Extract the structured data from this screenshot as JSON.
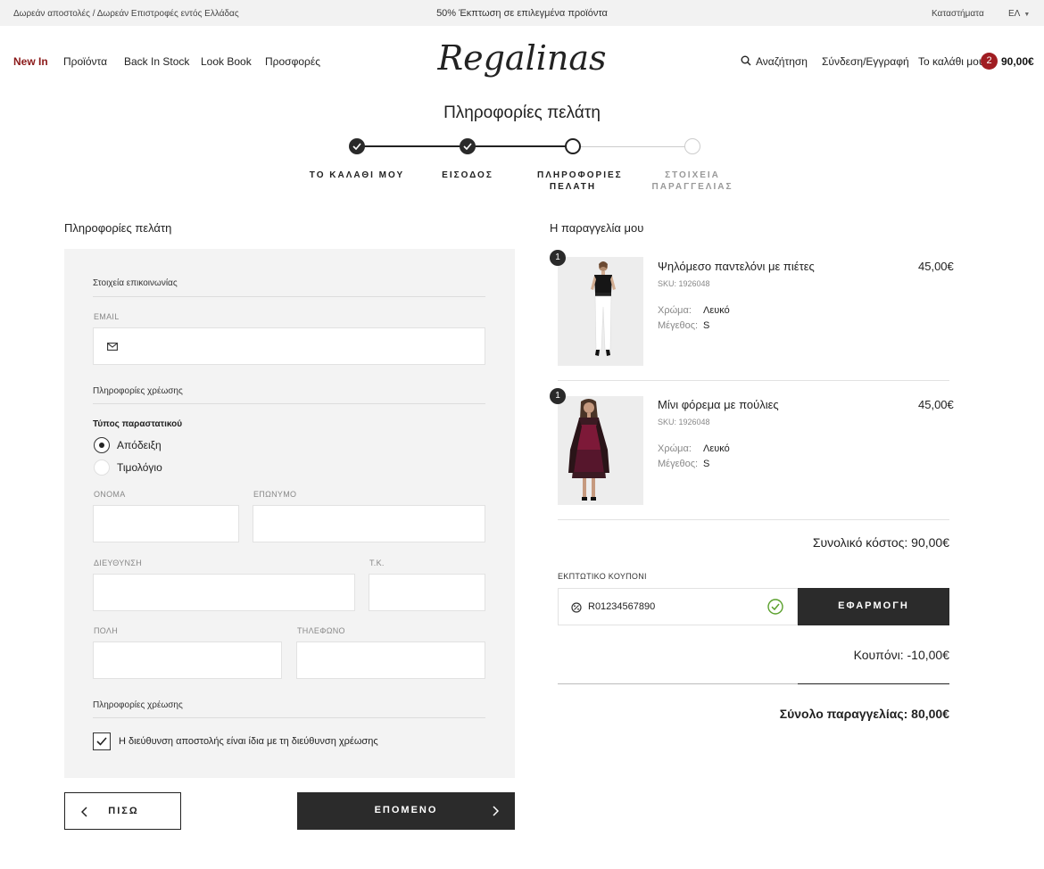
{
  "topbar": {
    "shipping_text": "Δωρεάν αποστολές / Δωρεάν Επιστροφές εντός Ελλάδας",
    "promo_text": "50% Έκπτωση σε επιλεγμένα προϊόντα",
    "stores_label": "Καταστήματα",
    "lang_label": "ΕΛ"
  },
  "header": {
    "logo_text": "Regalinas",
    "nav": {
      "new_in": "New In",
      "products": "Προϊόντα",
      "back_in_stock": "Back In Stock",
      "look_book": "Look Book",
      "offers": "Προσφορές"
    },
    "search_label": "Αναζήτηση",
    "login_label": "Σύνδεση/Εγγραφή",
    "cart_label": "Το καλάθι μου",
    "cart_count": "2",
    "cart_total": "90,00€"
  },
  "checkout": {
    "page_title": "Πληροφορίες πελάτη",
    "steps": [
      {
        "label": "ΤΟ ΚΑΛΑΘΙ ΜΟΥ",
        "state": "done"
      },
      {
        "label": "ΕΙΣΟΔΟΣ",
        "state": "done"
      },
      {
        "label": "ΠΛΗΡΟΦΟΡΙΕΣ ΠΕΛΑΤΗ",
        "state": "current"
      },
      {
        "label": "ΣΤΟΙΧΕΙΑ ΠΑΡΑΓΓΕΛΙΑΣ",
        "state": "todo"
      }
    ]
  },
  "form": {
    "heading": "Πληροφορίες πελάτη",
    "contact_heading": "Στοιχεία επικοινωνίας",
    "email_label": "EMAIL",
    "email_value": "",
    "billing_heading": "Πληροφορίες χρέωσης",
    "doc_type_label": "Τύπος παραστατικού",
    "doc_options": [
      {
        "label": "Απόδειξη",
        "selected": true
      },
      {
        "label": "Τιμολόγιο",
        "selected": false
      }
    ],
    "first_name_label": "ΟΝΟΜΑ",
    "last_name_label": "ΕΠΩΝΥΜΟ",
    "address_label": "ΔΙΕΥΘΥΝΣΗ",
    "postcode_label": "Τ.Κ.",
    "city_label": "ΠΟΛΗ",
    "phone_label": "ΤΗΛΕΦΩΝΟ",
    "billing_heading_2": "Πληροφορίες χρέωσης",
    "same_address_label": "Η διεύθυνση αποστολής είναι ίδια με τη διεύθυνση χρέωσης",
    "same_address_checked": true,
    "back_label": "ΠΙΣΩ",
    "next_label": "ΕΠΟΜΕΝΟ"
  },
  "order": {
    "heading": "Η παραγγελία μου",
    "items": [
      {
        "qty": "1",
        "name": "Ψηλόμεσο παντελόνι με πιέτες",
        "sku": "SKU: 1926048",
        "price": "45,00€",
        "color_key": "Χρώμα:",
        "color_val": "Λευκό",
        "size_key": "Μέγεθος:",
        "size_val": "S"
      },
      {
        "qty": "1",
        "name": "Μίνι φόρεμα με πούλιες",
        "sku": "SKU: 1926048",
        "price": "45,00€",
        "color_key": "Χρώμα:",
        "color_val": "Λευκό",
        "size_key": "Μέγεθος:",
        "size_val": "S"
      }
    ],
    "subtotal": "Συνολικό κόστος: 90,00€",
    "coupon_label": "ΕΚΠΤΩΤΙΚΟ ΚΟΥΠΟΝΙ",
    "coupon_value": "R01234567890",
    "apply_label": "ΕΦΑΡΜΟΓΗ",
    "coupon_discount": "Κουπόνι: -10,00€",
    "grand_total": "Σύνολο παραγγελίας: 80,00€"
  },
  "colors": {
    "brand_red": "#a01d22",
    "dark_button": "#2b2b2b",
    "panel_bg": "#f3f3f3",
    "success_green": "#5aa02c"
  },
  "icons": [
    "search-icon",
    "mail-icon",
    "check-icon",
    "coupon-icon",
    "chevron-left-icon",
    "chevron-right-icon",
    "chevron-down-icon"
  ]
}
